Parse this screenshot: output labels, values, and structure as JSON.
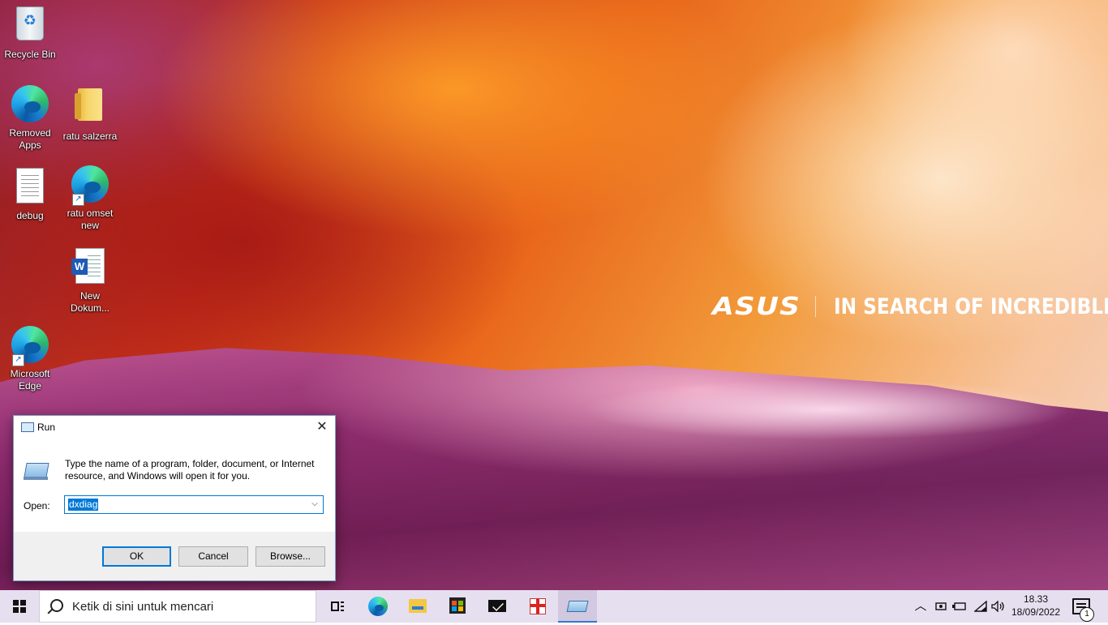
{
  "wallpaper": {
    "brand_logo": "ASUS",
    "brand_tagline": "IN SEARCH OF INCREDIBLE"
  },
  "desktop_icons": [
    {
      "label": "Recycle Bin",
      "icon": "recycle-bin-icon"
    },
    {
      "label": "Removed Apps",
      "icon": "edge-icon"
    },
    {
      "label": "ratu salzerra",
      "icon": "folder-icon"
    },
    {
      "label": "debug",
      "icon": "text-document-icon"
    },
    {
      "label": "ratu omset new",
      "icon": "edge-shortcut-icon"
    },
    {
      "label": "New Dokum...",
      "icon": "word-document-icon"
    },
    {
      "label": "Microsoft Edge",
      "icon": "edge-shortcut-icon"
    }
  ],
  "run_dialog": {
    "title": "Run",
    "close_glyph": "✕",
    "description": "Type the name of a program, folder, document, or Internet resource, and Windows will open it for you.",
    "open_label": "Open:",
    "open_value": "dxdiag",
    "ok_label": "OK",
    "cancel_label": "Cancel",
    "browse_label": "Browse..."
  },
  "taskbar": {
    "search_placeholder": "Ketik di sini untuk mencari",
    "pinned": [
      "task-view",
      "microsoft-edge",
      "file-explorer",
      "microsoft-store",
      "mail",
      "gift",
      "run"
    ],
    "active_app": "run",
    "tray": {
      "show_hidden_glyph": "︿",
      "time": "18.33",
      "date": "18/09/2022",
      "notification_count": "1"
    }
  },
  "colors": {
    "accent": "#0078d7",
    "taskbar_bg": "#e6dff0"
  }
}
